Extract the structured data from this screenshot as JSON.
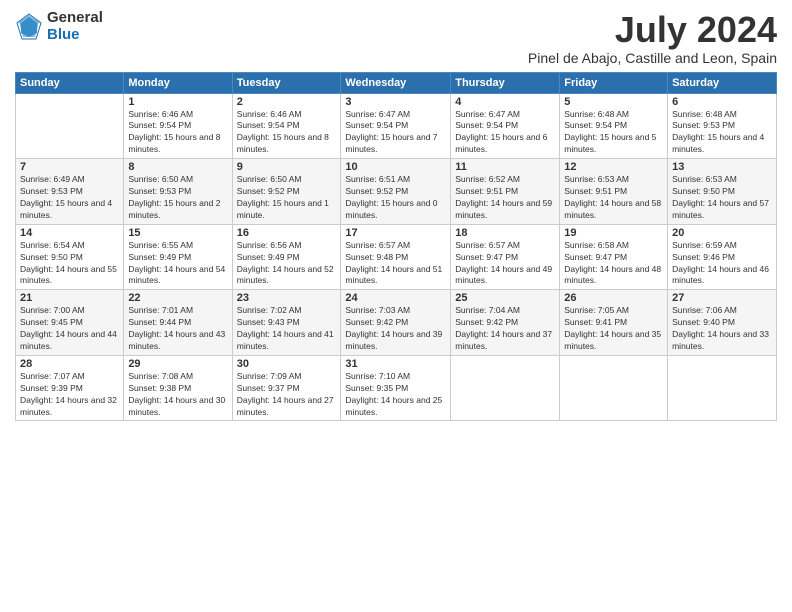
{
  "logo": {
    "general": "General",
    "blue": "Blue"
  },
  "title": {
    "month_year": "July 2024",
    "location": "Pinel de Abajo, Castille and Leon, Spain"
  },
  "weekdays": [
    "Sunday",
    "Monday",
    "Tuesday",
    "Wednesday",
    "Thursday",
    "Friday",
    "Saturday"
  ],
  "weeks": [
    [
      {
        "num": "",
        "sunrise": "",
        "sunset": "",
        "daylight": ""
      },
      {
        "num": "1",
        "sunrise": "Sunrise: 6:46 AM",
        "sunset": "Sunset: 9:54 PM",
        "daylight": "Daylight: 15 hours and 8 minutes."
      },
      {
        "num": "2",
        "sunrise": "Sunrise: 6:46 AM",
        "sunset": "Sunset: 9:54 PM",
        "daylight": "Daylight: 15 hours and 8 minutes."
      },
      {
        "num": "3",
        "sunrise": "Sunrise: 6:47 AM",
        "sunset": "Sunset: 9:54 PM",
        "daylight": "Daylight: 15 hours and 7 minutes."
      },
      {
        "num": "4",
        "sunrise": "Sunrise: 6:47 AM",
        "sunset": "Sunset: 9:54 PM",
        "daylight": "Daylight: 15 hours and 6 minutes."
      },
      {
        "num": "5",
        "sunrise": "Sunrise: 6:48 AM",
        "sunset": "Sunset: 9:54 PM",
        "daylight": "Daylight: 15 hours and 5 minutes."
      },
      {
        "num": "6",
        "sunrise": "Sunrise: 6:48 AM",
        "sunset": "Sunset: 9:53 PM",
        "daylight": "Daylight: 15 hours and 4 minutes."
      }
    ],
    [
      {
        "num": "7",
        "sunrise": "Sunrise: 6:49 AM",
        "sunset": "Sunset: 9:53 PM",
        "daylight": "Daylight: 15 hours and 4 minutes."
      },
      {
        "num": "8",
        "sunrise": "Sunrise: 6:50 AM",
        "sunset": "Sunset: 9:53 PM",
        "daylight": "Daylight: 15 hours and 2 minutes."
      },
      {
        "num": "9",
        "sunrise": "Sunrise: 6:50 AM",
        "sunset": "Sunset: 9:52 PM",
        "daylight": "Daylight: 15 hours and 1 minute."
      },
      {
        "num": "10",
        "sunrise": "Sunrise: 6:51 AM",
        "sunset": "Sunset: 9:52 PM",
        "daylight": "Daylight: 15 hours and 0 minutes."
      },
      {
        "num": "11",
        "sunrise": "Sunrise: 6:52 AM",
        "sunset": "Sunset: 9:51 PM",
        "daylight": "Daylight: 14 hours and 59 minutes."
      },
      {
        "num": "12",
        "sunrise": "Sunrise: 6:53 AM",
        "sunset": "Sunset: 9:51 PM",
        "daylight": "Daylight: 14 hours and 58 minutes."
      },
      {
        "num": "13",
        "sunrise": "Sunrise: 6:53 AM",
        "sunset": "Sunset: 9:50 PM",
        "daylight": "Daylight: 14 hours and 57 minutes."
      }
    ],
    [
      {
        "num": "14",
        "sunrise": "Sunrise: 6:54 AM",
        "sunset": "Sunset: 9:50 PM",
        "daylight": "Daylight: 14 hours and 55 minutes."
      },
      {
        "num": "15",
        "sunrise": "Sunrise: 6:55 AM",
        "sunset": "Sunset: 9:49 PM",
        "daylight": "Daylight: 14 hours and 54 minutes."
      },
      {
        "num": "16",
        "sunrise": "Sunrise: 6:56 AM",
        "sunset": "Sunset: 9:49 PM",
        "daylight": "Daylight: 14 hours and 52 minutes."
      },
      {
        "num": "17",
        "sunrise": "Sunrise: 6:57 AM",
        "sunset": "Sunset: 9:48 PM",
        "daylight": "Daylight: 14 hours and 51 minutes."
      },
      {
        "num": "18",
        "sunrise": "Sunrise: 6:57 AM",
        "sunset": "Sunset: 9:47 PM",
        "daylight": "Daylight: 14 hours and 49 minutes."
      },
      {
        "num": "19",
        "sunrise": "Sunrise: 6:58 AM",
        "sunset": "Sunset: 9:47 PM",
        "daylight": "Daylight: 14 hours and 48 minutes."
      },
      {
        "num": "20",
        "sunrise": "Sunrise: 6:59 AM",
        "sunset": "Sunset: 9:46 PM",
        "daylight": "Daylight: 14 hours and 46 minutes."
      }
    ],
    [
      {
        "num": "21",
        "sunrise": "Sunrise: 7:00 AM",
        "sunset": "Sunset: 9:45 PM",
        "daylight": "Daylight: 14 hours and 44 minutes."
      },
      {
        "num": "22",
        "sunrise": "Sunrise: 7:01 AM",
        "sunset": "Sunset: 9:44 PM",
        "daylight": "Daylight: 14 hours and 43 minutes."
      },
      {
        "num": "23",
        "sunrise": "Sunrise: 7:02 AM",
        "sunset": "Sunset: 9:43 PM",
        "daylight": "Daylight: 14 hours and 41 minutes."
      },
      {
        "num": "24",
        "sunrise": "Sunrise: 7:03 AM",
        "sunset": "Sunset: 9:42 PM",
        "daylight": "Daylight: 14 hours and 39 minutes."
      },
      {
        "num": "25",
        "sunrise": "Sunrise: 7:04 AM",
        "sunset": "Sunset: 9:42 PM",
        "daylight": "Daylight: 14 hours and 37 minutes."
      },
      {
        "num": "26",
        "sunrise": "Sunrise: 7:05 AM",
        "sunset": "Sunset: 9:41 PM",
        "daylight": "Daylight: 14 hours and 35 minutes."
      },
      {
        "num": "27",
        "sunrise": "Sunrise: 7:06 AM",
        "sunset": "Sunset: 9:40 PM",
        "daylight": "Daylight: 14 hours and 33 minutes."
      }
    ],
    [
      {
        "num": "28",
        "sunrise": "Sunrise: 7:07 AM",
        "sunset": "Sunset: 9:39 PM",
        "daylight": "Daylight: 14 hours and 32 minutes."
      },
      {
        "num": "29",
        "sunrise": "Sunrise: 7:08 AM",
        "sunset": "Sunset: 9:38 PM",
        "daylight": "Daylight: 14 hours and 30 minutes."
      },
      {
        "num": "30",
        "sunrise": "Sunrise: 7:09 AM",
        "sunset": "Sunset: 9:37 PM",
        "daylight": "Daylight: 14 hours and 27 minutes."
      },
      {
        "num": "31",
        "sunrise": "Sunrise: 7:10 AM",
        "sunset": "Sunset: 9:35 PM",
        "daylight": "Daylight: 14 hours and 25 minutes."
      },
      {
        "num": "",
        "sunrise": "",
        "sunset": "",
        "daylight": ""
      },
      {
        "num": "",
        "sunrise": "",
        "sunset": "",
        "daylight": ""
      },
      {
        "num": "",
        "sunrise": "",
        "sunset": "",
        "daylight": ""
      }
    ]
  ]
}
